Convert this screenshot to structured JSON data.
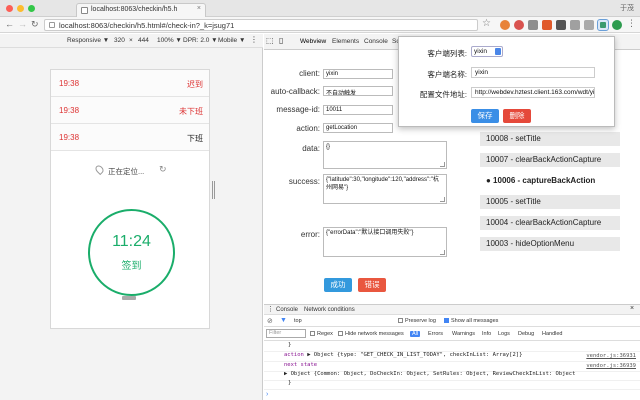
{
  "browser": {
    "tab_title": "localhost:8063/checkin/h5.h",
    "tab_close": "×",
    "profile": "于茂",
    "url": "localhost:8063/checkin/h5.html#/check-in?_k=jsug71",
    "star": "☆",
    "nav": {
      "back": "←",
      "forward": "→",
      "reload": "↻"
    },
    "colors": {
      "close": "#fc5f57",
      "minimize": "#fdbc2e",
      "maximize": "#33c748",
      "ext1": "#e8833a",
      "ext2": "#d9534f",
      "ext3": "#8e8e8e",
      "ext4": "#e05a2b",
      "ext5": "#555555",
      "ext6": "#a0a0a0",
      "ext_active": "#3b9b6e",
      "ext8": "#2e9c4f"
    }
  },
  "device_toolbar": {
    "device": "Responsive ▼",
    "width": "320",
    "times": "×",
    "height": "444",
    "zoom": "100% ▼",
    "dpr": "DPR: 2.0 ▼",
    "mode": "Mobile ▼"
  },
  "phone": {
    "rows": [
      {
        "time": "19:38",
        "status": "迟到"
      },
      {
        "time": "19:38",
        "status": "未下班"
      },
      {
        "time": "19:38",
        "status": "下班"
      }
    ],
    "locating": "正在定位...",
    "refresh": "↻",
    "checkin_time": "11:24",
    "checkin_label": "签到",
    "colors": {
      "late": "#dd3333",
      "green": "#1aad6a"
    }
  },
  "devtools": {
    "tabs": [
      "Webview",
      "Elements",
      "Console",
      "So"
    ],
    "form": {
      "client_label": "client:",
      "client_value": "yixin",
      "auto_callback_label": "auto-callback:",
      "auto_callback_value": "不自动触发",
      "message_id_label": "message-id:",
      "message_id_value": "10011",
      "action_label": "action:",
      "action_value": "getLocation",
      "data_label": "data:",
      "data_value": "{}",
      "success_label": "success:",
      "success_value": "{\"latitude\":30,\"longitude\":120,\"address\":\"杭州网易\"}",
      "error_label": "error:",
      "error_value": "{\"errorData\":\"默认接口调用失败\"}",
      "success_button": "成功",
      "error_button": "错误"
    },
    "history": [
      {
        "label": "10008 - setTitle",
        "current": false
      },
      {
        "label": "10007 - clearBackActionCapture",
        "current": false
      },
      {
        "label": "● 10006 - captureBackAction",
        "current": true
      },
      {
        "label": "10005 - setTitle",
        "current": false
      },
      {
        "label": "10004 - clearBackActionCapture",
        "current": false
      },
      {
        "label": "10003 - hideOptionMenu",
        "current": false
      }
    ],
    "colors": {
      "success": "#3399dd",
      "error": "#e9573f",
      "primary": "#3a8ee6",
      "danger": "#e5493a"
    }
  },
  "console": {
    "tabs": [
      "Console",
      "Network conditions"
    ],
    "close": "×",
    "context": "top",
    "preserve_log": "Preserve log",
    "show_all": "Show all messages",
    "filter_placeholder": "Filter",
    "regex": "Regex",
    "hide_network": "Hide network messages",
    "levels": [
      "All",
      "Errors",
      "Warnings",
      "Info",
      "Logs",
      "Debug",
      "Handled"
    ],
    "lines": [
      {
        "text": "}",
        "src": ""
      },
      {
        "key": "action",
        "text": "▶ Object {type: \"GET_CHECK_IN_LIST_TODAY\", checkInList: Array[2]}",
        "src": "vendor.js:36931"
      },
      {
        "key": "next state",
        "text": "",
        "src": "vendor.js:36939"
      },
      {
        "text": "▶ Object {Common: Object, DoCheckIn: Object, SetRules: Object, ReviewCheckInList: Object",
        "src": ""
      },
      {
        "text": "}",
        "src": ""
      }
    ],
    "prompt": "›"
  },
  "popup": {
    "client_list_label": "客户端列表:",
    "client_list_value": "yixin",
    "client_name_label": "客户端名称:",
    "client_name_value": "yixin",
    "config_label": "配置文件地址:",
    "config_value": "http://webdev.hztest.client.163.com/wdt/yixin_c",
    "save": "保存",
    "delete": "删除"
  }
}
